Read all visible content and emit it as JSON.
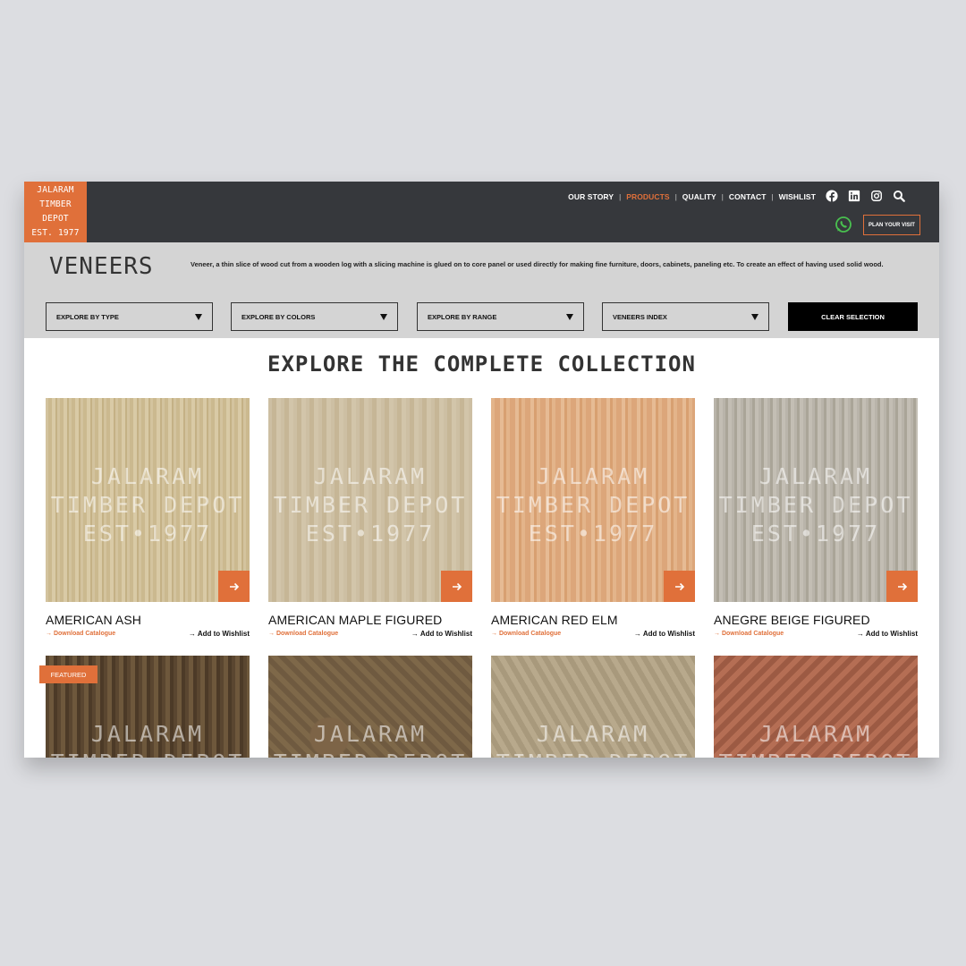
{
  "logo": {
    "line1": "JALARAM",
    "line2": "TIMBER DEPOT",
    "line3": "EST. 1977"
  },
  "nav": {
    "items": [
      {
        "label": "OUR STORY",
        "active": false
      },
      {
        "label": "PRODUCTS",
        "active": true
      },
      {
        "label": "QUALITY",
        "active": false
      },
      {
        "label": "CONTACT",
        "active": false
      },
      {
        "label": "WISHLIST",
        "active": false
      }
    ],
    "social_icons": [
      "facebook-icon",
      "linkedin-icon",
      "instagram-icon",
      "search-icon"
    ],
    "whatsapp_icon": "whatsapp-icon",
    "plan_visit_label": "PLAN YOUR VISIT"
  },
  "page": {
    "title": "VENEERS",
    "description": "Veneer, a thin slice of wood cut from a wooden log with a slicing machine is glued on to core panel or used directly for making fine furniture, doors, cabinets, paneling etc. To create an effect of having used solid wood."
  },
  "filters": [
    {
      "label": "EXPLORE BY TYPE"
    },
    {
      "label": "EXPLORE BY COLORS"
    },
    {
      "label": "EXPLORE BY RANGE"
    },
    {
      "label": "VENEERS INDEX"
    }
  ],
  "clear_label": "CLEAR SELECTION",
  "collection_title": "EXPLORE THE COMPLETE COLLECTION",
  "watermark": {
    "line1": "JALARAM",
    "line2": "TIMBER DEPOT",
    "line3": "EST•1977"
  },
  "products": [
    {
      "name": "AMERICAN ASH",
      "download": "Download Catalogue",
      "wishlist": "Add to Wishlist"
    },
    {
      "name": "AMERICAN MAPLE FIGURED",
      "download": "Download Catalogue",
      "wishlist": "Add to Wishlist"
    },
    {
      "name": "AMERICAN RED ELM",
      "download": "Download Catalogue",
      "wishlist": "Add to Wishlist"
    },
    {
      "name": "ANEGRE BEIGE FIGURED",
      "download": "Download Catalogue",
      "wishlist": "Add to Wishlist"
    }
  ],
  "featured_label": "FEATURED",
  "accent_color": "#e0703a",
  "header_color": "#36383c"
}
